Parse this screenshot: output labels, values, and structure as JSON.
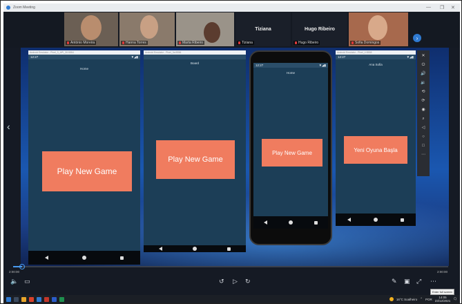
{
  "window": {
    "title": "Zoom Meeting",
    "controls": [
      "—",
      "❐",
      "✕"
    ]
  },
  "participants": [
    {
      "name": "António Moreira",
      "muted": true
    },
    {
      "name": "Hanna Torres",
      "muted": true
    },
    {
      "name": "Marta Ribeiro",
      "muted": true
    },
    {
      "name": "Tiziana",
      "muted": true,
      "video_off": true
    },
    {
      "name": "Hugo Ribeiro",
      "muted": true,
      "video_off": true
    },
    {
      "name": "Sofia Domingos",
      "muted": true
    }
  ],
  "emulators": [
    {
      "url": "Android Emulator - Pixel_3_API_30:5554",
      "time": "12:27",
      "signal": "▼◢▮",
      "page_title": "Home",
      "button": "Play New Game"
    },
    {
      "url": "Android Emulator - Pixel_3a:5556",
      "time": "",
      "signal": "",
      "page_title": "Board",
      "button": "Play New Game"
    },
    {
      "url": "",
      "time": "12:27",
      "signal": "▼◢▮",
      "page_title": "Home",
      "button": "Play New Game"
    },
    {
      "url": "Android Emulator - Pixel_4:5558",
      "time": "12:27",
      "signal": "▼◢▮",
      "page_title": "Ana Sofia",
      "button": "Yeni Oyuna Başla"
    }
  ],
  "player": {
    "elapsed": "2:00:00",
    "duration": "2:00:00",
    "progress_fraction": 0.02,
    "tooltip": "Enter full screen"
  },
  "taskbar": {
    "weather": "16°C  Soalheiro",
    "lang": "POR",
    "clock_time": "14:05",
    "clock_date": "23/12/2021"
  },
  "colors": {
    "accent": "#2f7ad1",
    "play_button": "#f07c5f",
    "app_bg": "#1c3e57"
  }
}
